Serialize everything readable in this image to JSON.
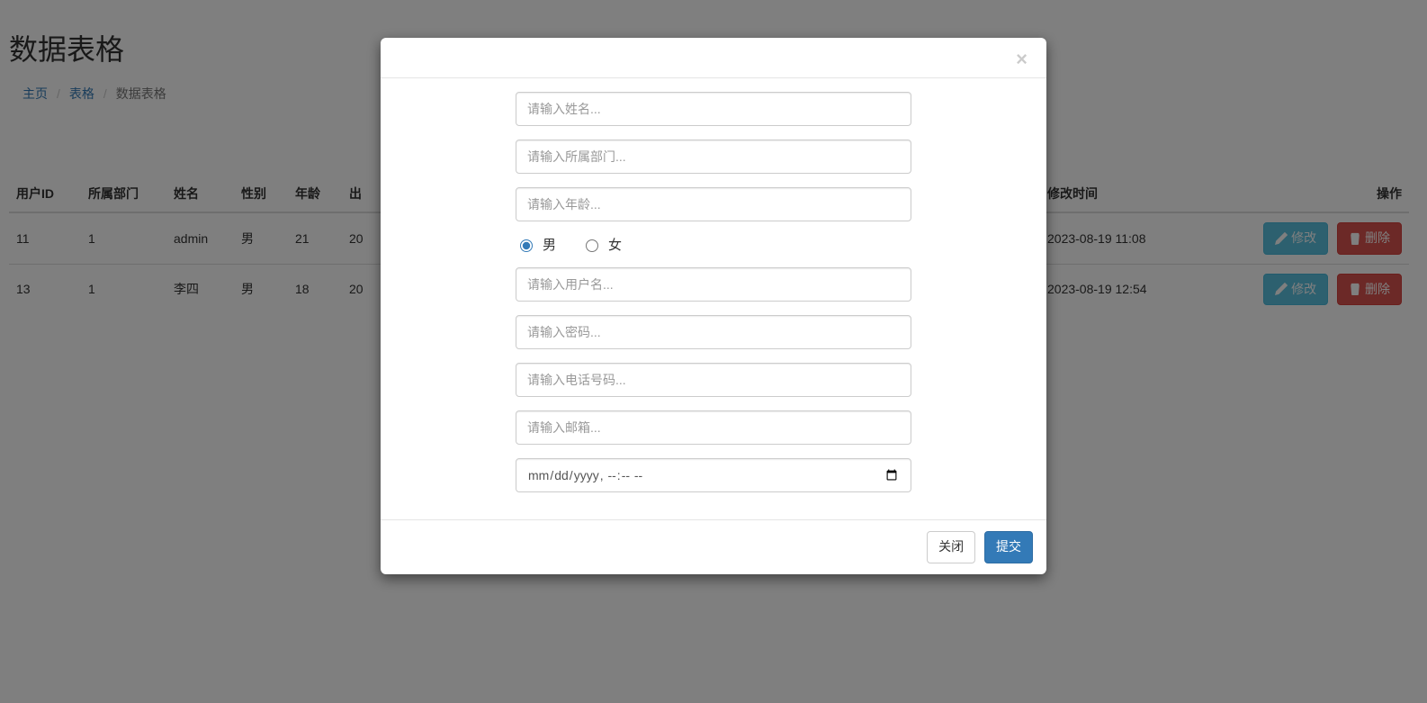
{
  "page": {
    "title": "数据表格"
  },
  "breadcrumb": {
    "home": "主页",
    "tables": "表格",
    "current": "数据表格"
  },
  "search": {
    "placeholder": "请输入姓名"
  },
  "table": {
    "headers": {
      "id": "用户ID",
      "dept": "所属部门",
      "name": "姓名",
      "sex": "性别",
      "age": "年龄",
      "birth": "出",
      "mtime": "修改时间",
      "ops": "操作"
    },
    "rows": [
      {
        "id": "11",
        "dept": "1",
        "name": "admin",
        "sex": "男",
        "age": "21",
        "birth": "20",
        "mtime": "2023-08-19 11:08"
      },
      {
        "id": "13",
        "dept": "1",
        "name": "李四",
        "sex": "男",
        "age": "18",
        "birth": "20",
        "mtime": "2023-08-19 12:54"
      }
    ],
    "buttons": {
      "edit": "修改",
      "delete": "删除"
    }
  },
  "modal": {
    "fields": {
      "name_ph": "请输入姓名...",
      "dept_ph": "请输入所属部门...",
      "age_ph": "请输入年龄...",
      "male": "男",
      "female": "女",
      "username_ph": "请输入用户名...",
      "password_ph": "请输入密码...",
      "phone_ph": "请输入电话号码...",
      "email_ph": "请输入邮箱...",
      "date_ph": "年 /月/日 --:--"
    },
    "footer": {
      "close": "关闭",
      "submit": "提交"
    }
  }
}
